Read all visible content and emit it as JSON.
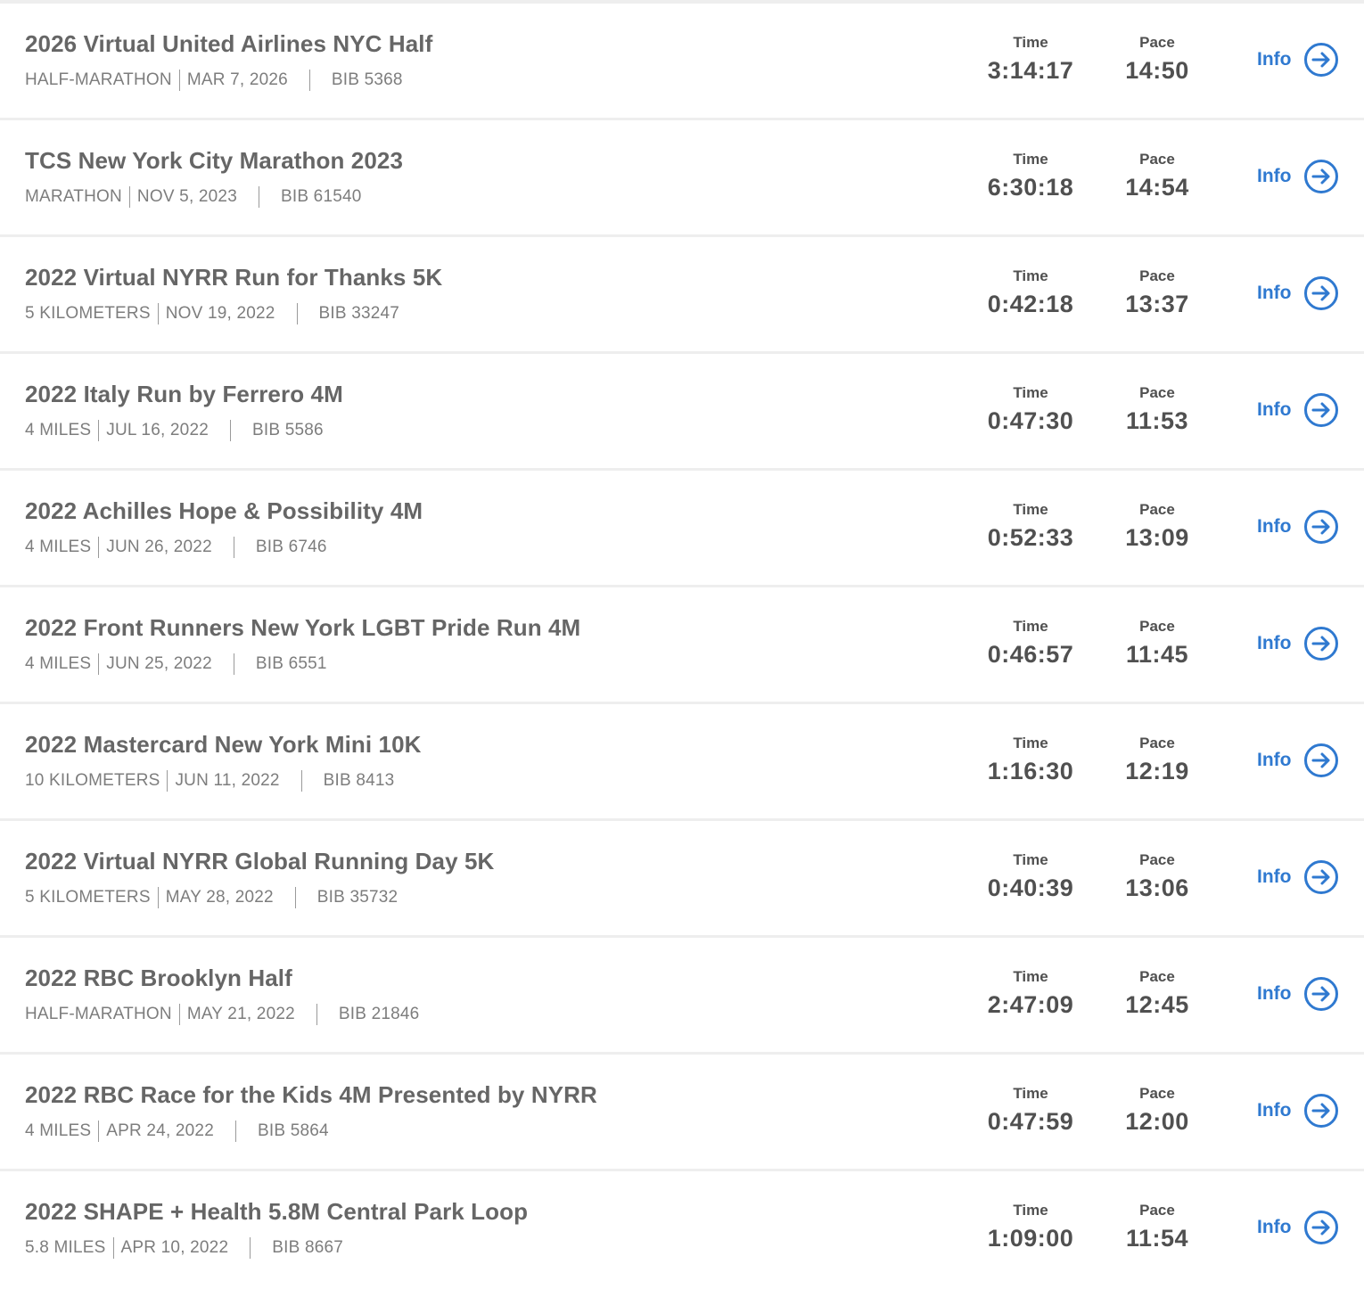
{
  "races": [
    {
      "title": "2026 Virtual United Airlines NYC Half",
      "distance": "HALF-MARATHON",
      "date": "MAR 7, 2026",
      "bib": "BIB 5368",
      "time_label": "Time",
      "time": "3:14:17",
      "pace_label": "Pace",
      "pace": "14:50",
      "info_label": "Info"
    },
    {
      "title": "TCS New York City Marathon 2023",
      "distance": "MARATHON",
      "date": "NOV 5, 2023",
      "bib": "BIB 61540",
      "time_label": "Time",
      "time": "6:30:18",
      "pace_label": "Pace",
      "pace": "14:54",
      "info_label": "Info"
    },
    {
      "title": "2022 Virtual NYRR Run for Thanks 5K",
      "distance": "5 KILOMETERS",
      "date": "NOV 19, 2022",
      "bib": "BIB 33247",
      "time_label": "Time",
      "time": "0:42:18",
      "pace_label": "Pace",
      "pace": "13:37",
      "info_label": "Info"
    },
    {
      "title": "2022 Italy Run by Ferrero 4M",
      "distance": "4 MILES",
      "date": "JUL 16, 2022",
      "bib": "BIB 5586",
      "time_label": "Time",
      "time": "0:47:30",
      "pace_label": "Pace",
      "pace": "11:53",
      "info_label": "Info"
    },
    {
      "title": "2022 Achilles Hope & Possibility 4M",
      "distance": "4 MILES",
      "date": "JUN 26, 2022",
      "bib": "BIB 6746",
      "time_label": "Time",
      "time": "0:52:33",
      "pace_label": "Pace",
      "pace": "13:09",
      "info_label": "Info"
    },
    {
      "title": "2022 Front Runners New York LGBT Pride Run 4M",
      "distance": "4 MILES",
      "date": "JUN 25, 2022",
      "bib": "BIB 6551",
      "time_label": "Time",
      "time": "0:46:57",
      "pace_label": "Pace",
      "pace": "11:45",
      "info_label": "Info"
    },
    {
      "title": "2022 Mastercard New York Mini 10K",
      "distance": "10 KILOMETERS",
      "date": "JUN 11, 2022",
      "bib": "BIB 8413",
      "time_label": "Time",
      "time": "1:16:30",
      "pace_label": "Pace",
      "pace": "12:19",
      "info_label": "Info"
    },
    {
      "title": "2022 Virtual NYRR Global Running Day 5K",
      "distance": "5 KILOMETERS",
      "date": "MAY 28, 2022",
      "bib": "BIB 35732",
      "time_label": "Time",
      "time": "0:40:39",
      "pace_label": "Pace",
      "pace": "13:06",
      "info_label": "Info"
    },
    {
      "title": "2022 RBC Brooklyn Half",
      "distance": "HALF-MARATHON",
      "date": "MAY 21, 2022",
      "bib": "BIB 21846",
      "time_label": "Time",
      "time": "2:47:09",
      "pace_label": "Pace",
      "pace": "12:45",
      "info_label": "Info"
    },
    {
      "title": "2022 RBC Race for the Kids 4M Presented by NYRR",
      "distance": "4 MILES",
      "date": "APR 24, 2022",
      "bib": "BIB 5864",
      "time_label": "Time",
      "time": "0:47:59",
      "pace_label": "Pace",
      "pace": "12:00",
      "info_label": "Info"
    },
    {
      "title": "2022 SHAPE + Health 5.8M Central Park Loop",
      "distance": "5.8 MILES",
      "date": "APR 10, 2022",
      "bib": "BIB 8667",
      "time_label": "Time",
      "time": "1:09:00",
      "pace_label": "Pace",
      "pace": "11:54",
      "info_label": "Info"
    }
  ],
  "colors": {
    "link": "#2f79d0",
    "title": "#666666",
    "meta": "#7d7d7d",
    "stat": "#505050",
    "divider": "#eeeeee"
  },
  "icons": {
    "info_arrow": "arrow-right-circle-icon"
  }
}
